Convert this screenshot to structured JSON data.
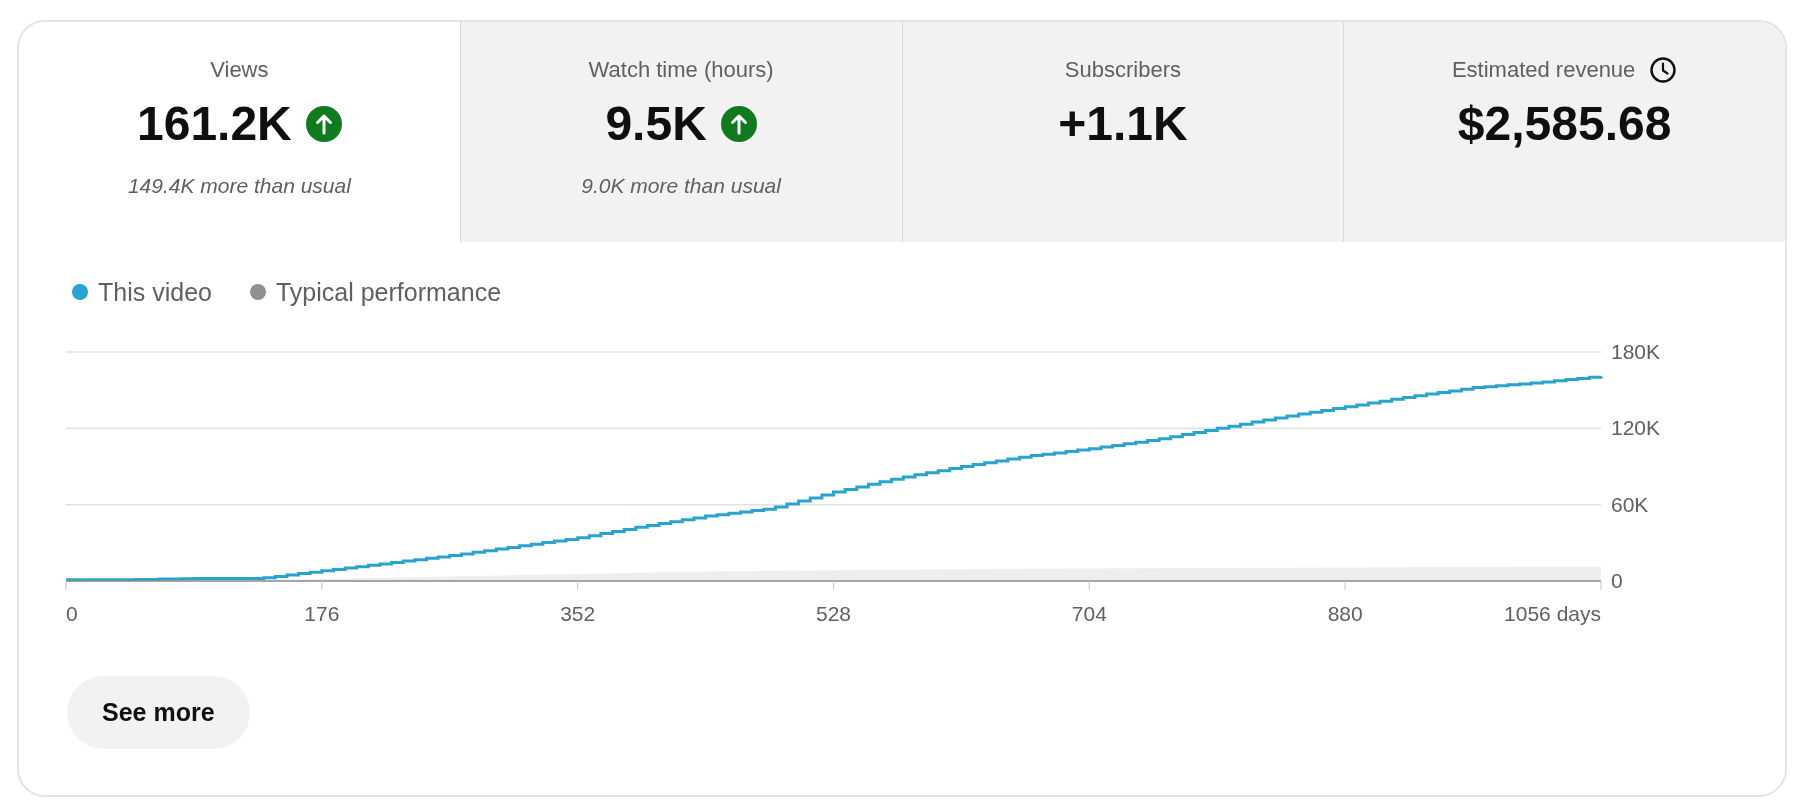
{
  "metric_tabs": [
    {
      "title": "Views",
      "value": "161.2K",
      "trend_up": true,
      "note": "149.4K more than usual",
      "clock_icon": false,
      "selected": true
    },
    {
      "title": "Watch time (hours)",
      "value": "9.5K",
      "trend_up": true,
      "note": "9.0K more than usual",
      "clock_icon": false,
      "selected": false
    },
    {
      "title": "Subscribers",
      "value": "+1.1K",
      "trend_up": false,
      "clock_icon": false,
      "selected": false
    },
    {
      "title": "Estimated revenue",
      "clock_icon": true,
      "value": "$2,585.68",
      "trend_up": false,
      "selected": false
    }
  ],
  "chart": {
    "chart_data": {
      "type": "line",
      "legend": "top",
      "x": [
        0,
        44,
        88,
        132,
        176,
        220,
        264,
        308,
        352,
        396,
        440,
        484,
        528,
        572,
        616,
        660,
        704,
        748,
        792,
        836,
        880,
        924,
        968,
        1012,
        1056
      ],
      "series": [
        {
          "name": "This video",
          "color": "#2aa3cf",
          "type": "line",
          "values": [
            1000,
            1000,
            2000,
            2000,
            8000,
            14000,
            20000,
            27000,
            34000,
            43000,
            51000,
            57000,
            70000,
            81000,
            90000,
            98000,
            104000,
            111000,
            120000,
            129000,
            137000,
            145000,
            152000,
            156000,
            161000
          ]
        },
        {
          "name": "Typical performance",
          "color": "#909090",
          "type": "area",
          "values": [
            0,
            0,
            0,
            500,
            1500,
            2500,
            3500,
            4500,
            5500,
            6500,
            7500,
            8000,
            8500,
            9000,
            9300,
            9600,
            9900,
            10100,
            10300,
            10500,
            10700,
            10800,
            10900,
            11000,
            11000
          ]
        }
      ],
      "xlim": [
        0,
        1056
      ],
      "ylim": [
        0,
        180000
      ],
      "xticks": [
        0,
        176,
        352,
        528,
        704,
        880,
        {
          "value": 1056,
          "label": "1056 days"
        }
      ],
      "yticks": [
        0,
        {
          "value": 60000,
          "label": "60K"
        },
        {
          "value": 120000,
          "label": "120K"
        },
        {
          "value": 180000,
          "label": "180K"
        }
      ]
    }
  },
  "see_more_button": {
    "label": "See more"
  }
}
